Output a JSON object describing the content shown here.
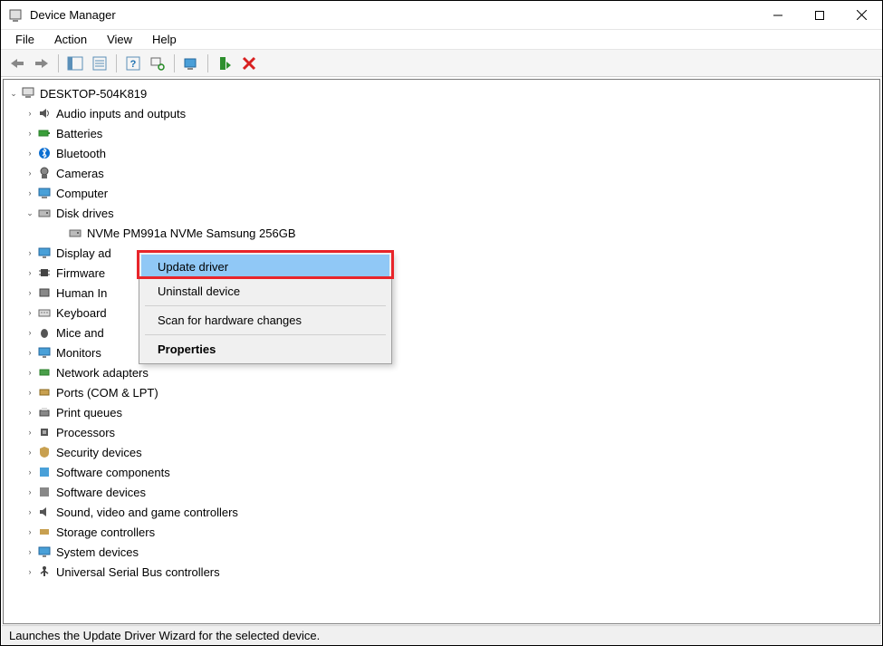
{
  "window": {
    "title": "Device Manager"
  },
  "menu": {
    "file": "File",
    "action": "Action",
    "view": "View",
    "help": "Help"
  },
  "tree": {
    "root": "DESKTOP-504K819",
    "items": [
      "Audio inputs and outputs",
      "Batteries",
      "Bluetooth",
      "Cameras",
      "Computer",
      "Disk drives",
      "Display adapters",
      "Firmware",
      "Human Interface Devices",
      "Keyboards",
      "Mice and other pointing devices",
      "Monitors",
      "Network adapters",
      "Ports (COM & LPT)",
      "Print queues",
      "Processors",
      "Security devices",
      "Software components",
      "Software devices",
      "Sound, video and game controllers",
      "Storage controllers",
      "System devices",
      "Universal Serial Bus controllers"
    ],
    "disk_child": "NVMe PM991a NVMe Samsung 256GB",
    "truncated": {
      "display": "Display ad",
      "firmware": "Firmware",
      "human": "Human In",
      "keyboards": "Keyboard",
      "mice": "Mice and"
    }
  },
  "context_menu": {
    "update": "Update driver",
    "uninstall": "Uninstall device",
    "scan": "Scan for hardware changes",
    "properties": "Properties"
  },
  "status": "Launches the Update Driver Wizard for the selected device."
}
